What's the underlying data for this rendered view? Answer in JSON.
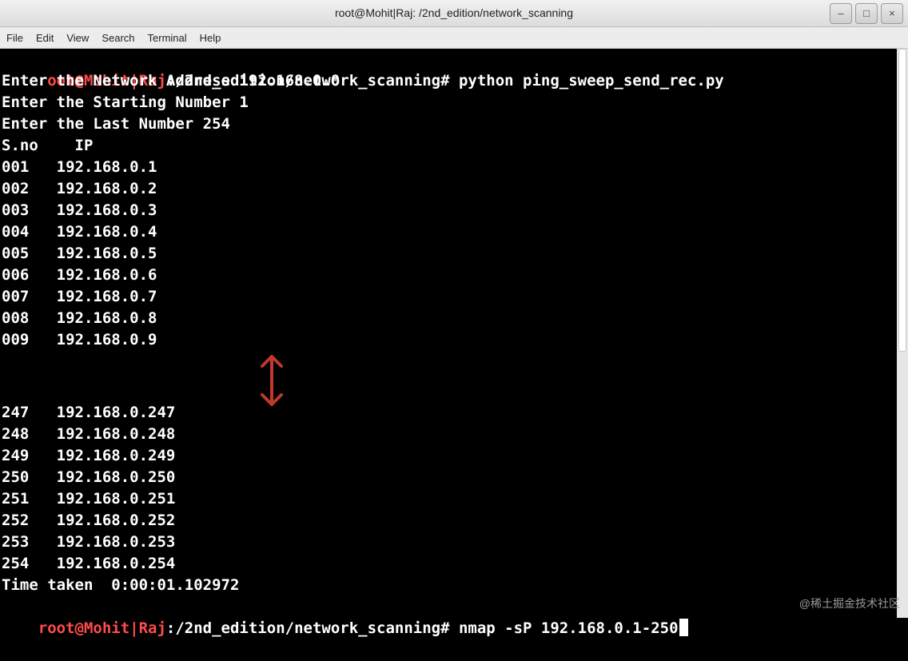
{
  "window": {
    "title": "root@Mohit|Raj: /2nd_edition/network_scanning",
    "minimize": "–",
    "maximize": "□",
    "close": "×"
  },
  "menubar": [
    "File",
    "Edit",
    "View",
    "Search",
    "Terminal",
    "Help"
  ],
  "terminal": {
    "prompt_user": "root@Mohit|Raj",
    "prompt_path": ":/2nd_edition/network_scanning#",
    "command1": " python ping_sweep_send_rec.py",
    "lines": [
      "Enter the Network Address 192.168.0.0",
      "Enter the Starting Number 1",
      "Enter the Last Number 254",
      "S.no    IP",
      "001   192.168.0.1",
      "002   192.168.0.2",
      "003   192.168.0.3",
      "004   192.168.0.4",
      "005   192.168.0.5",
      "006   192.168.0.6",
      "007   192.168.0.7",
      "008   192.168.0.8",
      "009   192.168.0.9"
    ],
    "lines_after": [
      "247   192.168.0.247",
      "248   192.168.0.248",
      "249   192.168.0.249",
      "250   192.168.0.250",
      "251   192.168.0.251",
      "252   192.168.0.252",
      "253   192.168.0.253",
      "254   192.168.0.254",
      "Time taken  0:00:01.102972"
    ],
    "command2": " nmap -sP 192.168.0.1-250"
  },
  "annotation": {
    "arrow_color": "#c0392b"
  },
  "watermark": "@稀土掘金技术社区"
}
